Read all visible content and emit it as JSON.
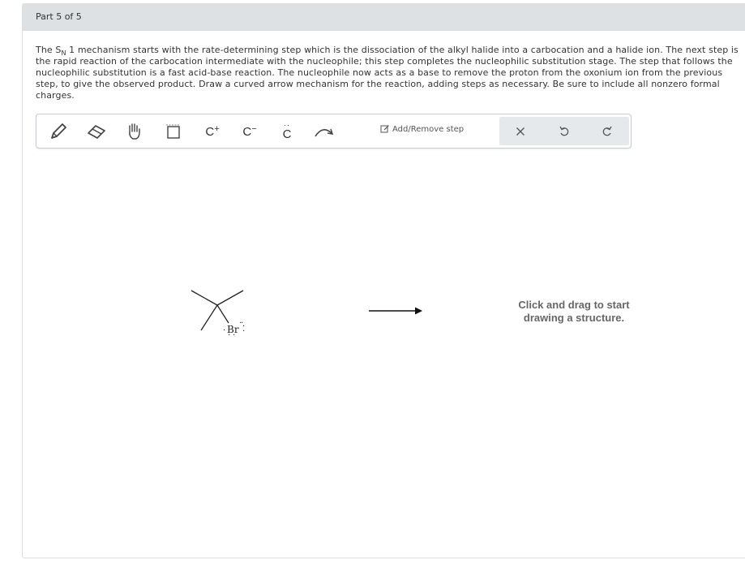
{
  "part": {
    "label": "Part 5 of 5"
  },
  "question": {
    "intro": "The S",
    "sub": "N",
    "body": " 1 mechanism starts with the rate-determining step which is the dissociation of the alkyl halide into a carbocation and a halide ion. The next step is the rapid reaction of the carbocation intermediate with the nucleophile; this step completes the nucleophilic substitution stage. The step that follows the nucleophilic substitution is a fast acid-base reaction. The nucleophile now acts as a base to remove the proton from the oxonium ion from the previous step, to give the observed product. Draw a curved arrow mechanism for the reaction, adding steps as necessary. Be sure to include all nonzero formal charges."
  },
  "toolbar": {
    "tools": [
      {
        "name": "pencil-icon"
      },
      {
        "name": "eraser-icon"
      },
      {
        "name": "hand-icon"
      },
      {
        "name": "select-box-icon"
      }
    ],
    "carbocation": {
      "atom": "C",
      "charge": "+"
    },
    "carbanion": {
      "atom": "C",
      "charge": "−"
    },
    "lone_pair": {
      "atom": "C"
    },
    "curved_arrow_icon": "curved-arrow-icon",
    "add_remove_step": "Add/Remove step",
    "clear_icon": "close-icon",
    "undo_icon": "undo-icon",
    "redo_icon": "redo-icon"
  },
  "canvas": {
    "reactant_atom": "Br",
    "hint_line1": "Click and drag to start",
    "hint_line2": "drawing a structure."
  }
}
